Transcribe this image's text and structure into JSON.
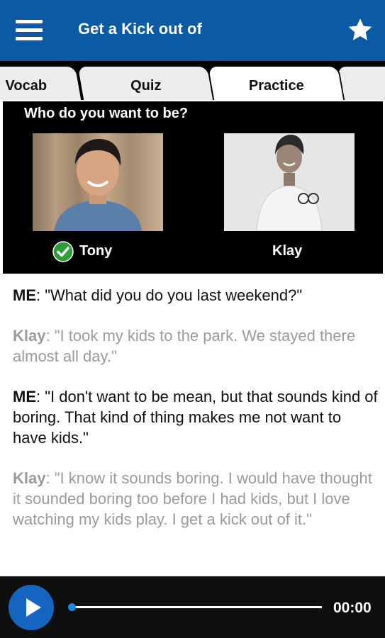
{
  "appbar": {
    "title": "Get a Kick out of"
  },
  "tabs": [
    {
      "label": "Vocab"
    },
    {
      "label": "Quiz"
    },
    {
      "label": "Practice"
    },
    {
      "label": ""
    }
  ],
  "chooser": {
    "title": "Who do you want to be?",
    "characters": [
      {
        "name": "Tony",
        "selected": true
      },
      {
        "name": "Klay",
        "selected": false
      }
    ]
  },
  "conversation": [
    {
      "speaker": "ME",
      "sep": ": ",
      "text": "\"What did you do you last weekend?\""
    },
    {
      "speaker": "Klay",
      "sep": ": ",
      "text": "\"I took my kids to the park.  We stayed there almost all day.\""
    },
    {
      "speaker": "ME",
      "sep": ": ",
      "text": "\"I don't want to be mean, but that sounds kind of boring.  That kind of thing makes me not want to have kids.\""
    },
    {
      "speaker": "Klay",
      "sep": ": ",
      "text": "\"I know it sounds boring.  I would have thought it sounded boring too before I had kids, but I love watching my kids play.  I get a kick out of it.\""
    }
  ],
  "player": {
    "time": "00:00",
    "progress": 0
  },
  "colors": {
    "appbar": "#0c5aa6",
    "accent": "#1565c0",
    "check": "#2e9d35"
  }
}
